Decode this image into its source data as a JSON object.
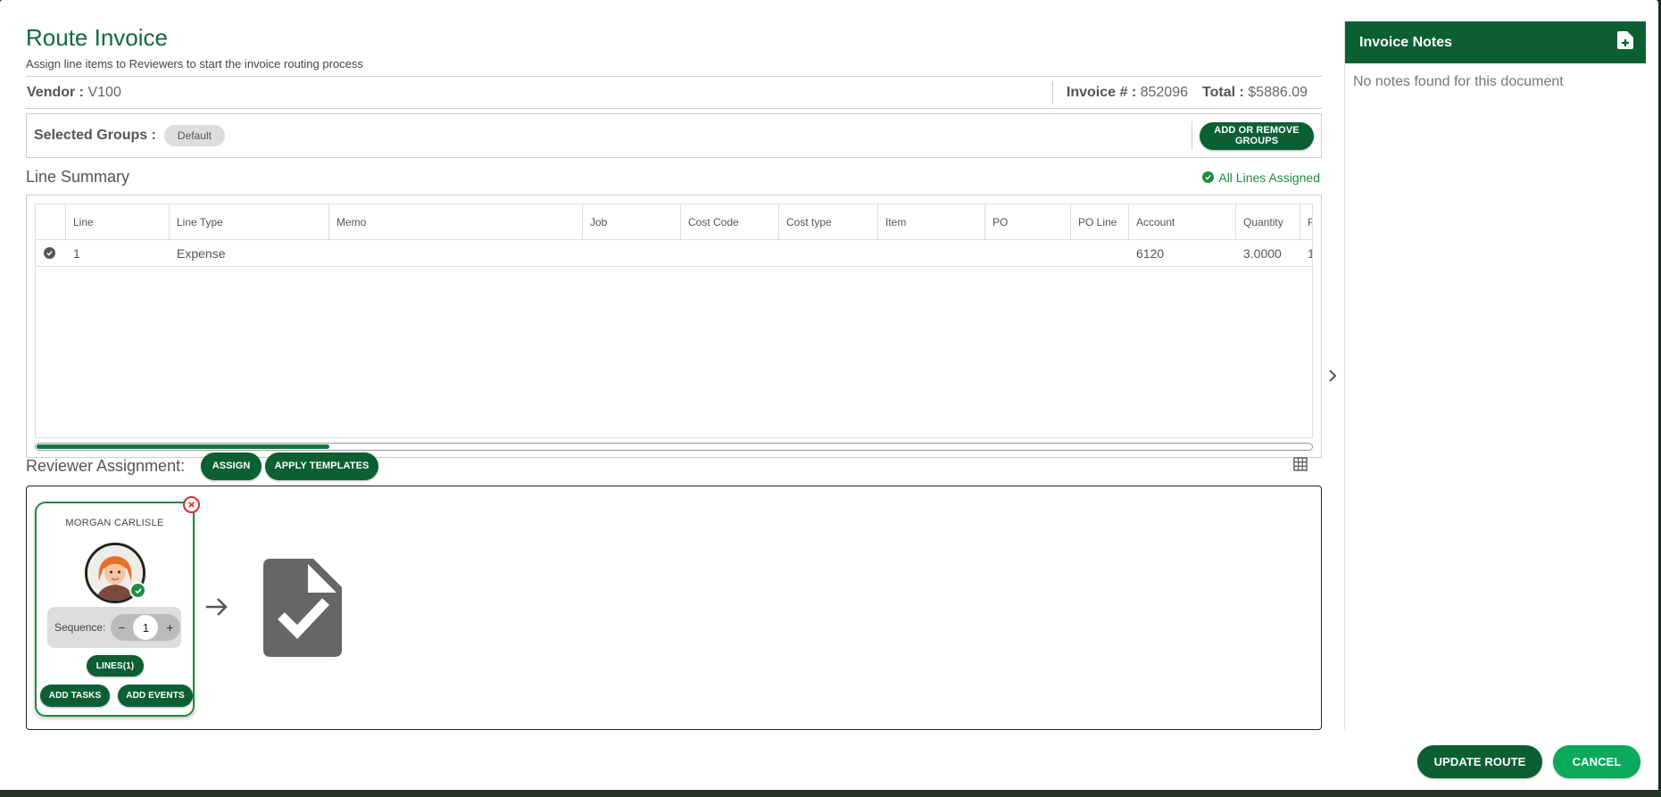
{
  "header": {
    "title": "Route Invoice",
    "subtitle": "Assign line items to Reviewers to start the invoice routing process"
  },
  "info": {
    "vendor_label": "Vendor :",
    "vendor_value": "V100",
    "invoice_label": "Invoice # :",
    "invoice_value": "852096",
    "total_label": "Total :",
    "total_value": "$5886.09"
  },
  "groups": {
    "label": "Selected Groups :",
    "chips": [
      "Default"
    ],
    "button_label": "ADD OR REMOVE GROUPS"
  },
  "summary": {
    "title": "Line Summary",
    "status": "All Lines Assigned",
    "columns": [
      "",
      "Line",
      "Line Type",
      "Memo",
      "Job",
      "Cost Code",
      "Cost type",
      "Item",
      "PO",
      "PO Line",
      "Account",
      "Quantity",
      "P"
    ],
    "rows": [
      {
        "line": "1",
        "line_type": "Expense",
        "memo": "",
        "job": "",
        "cost_code": "",
        "cost_type": "",
        "item": "",
        "po": "",
        "po_line": "",
        "account": "6120",
        "quantity": "3.0000",
        "p": "1"
      }
    ],
    "scroll_fraction": 0.23
  },
  "reviewers": {
    "title": "Reviewer Assignment:",
    "assign_label": "ASSIGN",
    "templates_label": "APPLY TEMPLATES",
    "cards": [
      {
        "name": "MORGAN CARLISLE",
        "sequence_label": "Sequence:",
        "sequence_value": "1",
        "lines_label": "LINES(1)",
        "tasks_label": "ADD TASKS",
        "events_label": "ADD EVENTS"
      }
    ]
  },
  "notes": {
    "title": "Invoice Notes",
    "empty": "No notes found for this document"
  },
  "footer": {
    "update_label": "UPDATE ROUTE",
    "cancel_label": "CANCEL"
  },
  "colors": {
    "brand": "#0c5f33",
    "accent": "#0aa95b",
    "success": "#1e8b3e",
    "danger": "#d32f2f"
  }
}
